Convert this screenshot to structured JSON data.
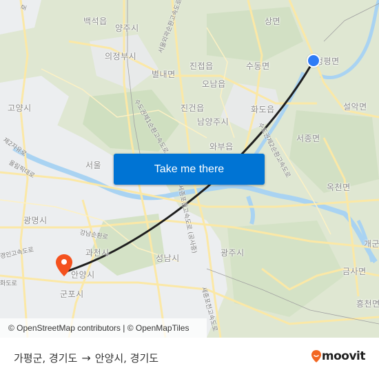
{
  "map": {
    "cta_label": "Take me there",
    "attribution": "© OpenStreetMap contributors | © OpenMapTiles",
    "origin_marker": {
      "label": "origin",
      "color": "#2f7cf6"
    },
    "destination_marker": {
      "label": "destination",
      "color": "#f4511e"
    },
    "places": [
      {
        "id": "baekseok",
        "label": "백석읍"
      },
      {
        "id": "yangju",
        "label": "양주시"
      },
      {
        "id": "sangmyeon",
        "label": "상면"
      },
      {
        "id": "uijeongbu",
        "label": "의정부시"
      },
      {
        "id": "jinjeop",
        "label": "진접읍"
      },
      {
        "id": "sudong",
        "label": "수동면"
      },
      {
        "id": "cheongpyeong",
        "label": "청평면"
      },
      {
        "id": "byeollae",
        "label": "별내면"
      },
      {
        "id": "onam",
        "label": "오남읍"
      },
      {
        "id": "goyang",
        "label": "고양시"
      },
      {
        "id": "jingeon",
        "label": "진건읍"
      },
      {
        "id": "hwado",
        "label": "화도읍"
      },
      {
        "id": "seorak",
        "label": "설악면"
      },
      {
        "id": "namyangju",
        "label": "남양주시"
      },
      {
        "id": "seojong",
        "label": "서종면"
      },
      {
        "id": "wabu",
        "label": "와부읍"
      },
      {
        "id": "seoul",
        "label": "서울"
      },
      {
        "id": "okcheon",
        "label": "옥천면"
      },
      {
        "id": "gwangmyeong",
        "label": "광명시"
      },
      {
        "id": "gaegun",
        "label": "개군"
      },
      {
        "id": "gwacheon",
        "label": "과천시"
      },
      {
        "id": "gwangju",
        "label": "광주시"
      },
      {
        "id": "seongnam",
        "label": "성남시"
      },
      {
        "id": "anyang",
        "label": "안양시"
      },
      {
        "id": "geumsa",
        "label": "금사면"
      },
      {
        "id": "gunpo",
        "label": "군포시"
      },
      {
        "id": "heungcheon",
        "label": "흥천면"
      }
    ],
    "roads": [
      {
        "id": "jayu",
        "label": "제2자유로"
      },
      {
        "id": "olympic",
        "label": "올림픽대로"
      },
      {
        "id": "gangnam-ring",
        "label": "강남순환로"
      },
      {
        "id": "gyeongin",
        "label": "경인고속도로"
      },
      {
        "id": "hwado-ro",
        "label": "화도로"
      },
      {
        "id": "seoul-ring-1",
        "label": "수도권제1순환고속도로"
      },
      {
        "id": "seoul-ring-2",
        "label": "수도권제2순환고속도로"
      },
      {
        "id": "north-ring",
        "label": "서울외곽순환고속도로"
      },
      {
        "id": "sejong-pocheon",
        "label": "세종포천고속도로"
      },
      {
        "id": "sejong-pocheon-2",
        "label": "세종포천고속도로 (공사중)"
      },
      {
        "id": "north-road",
        "label": "로"
      }
    ]
  },
  "footer": {
    "origin": "가평군, 경기도",
    "arrow": "→",
    "destination": "안양시, 경기도",
    "brand": "moovit",
    "brand_color": "#f26722"
  }
}
